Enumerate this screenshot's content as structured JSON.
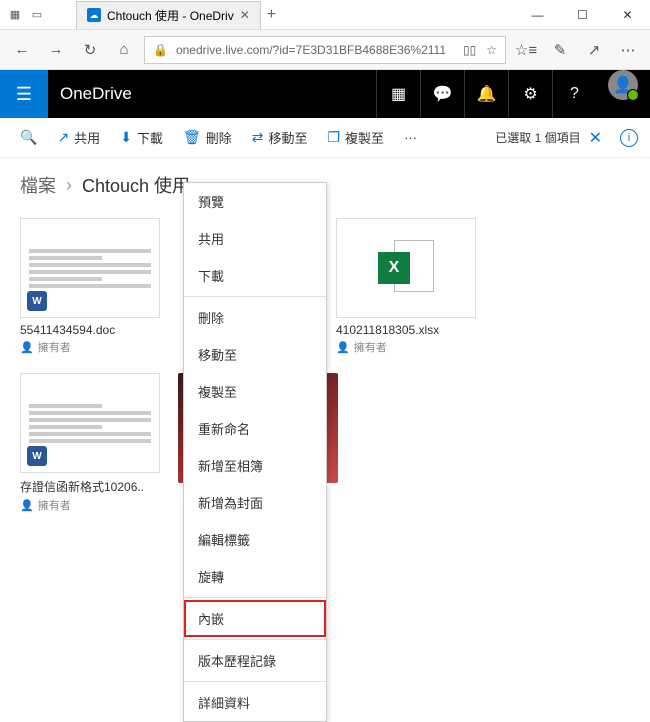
{
  "window": {
    "tab_title": "Chtouch 使用 - OneDriv",
    "min": "—",
    "max": "☐",
    "close": "✕",
    "plus": "+",
    "tabx": "✕"
  },
  "nav": {
    "url": "onedrive.live.com/?id=7E3D31BFB4688E36%2111"
  },
  "header": {
    "brand": "OneDrive"
  },
  "toolbar": {
    "share": "共用",
    "download": "下載",
    "delete": "刪除",
    "move": "移動至",
    "copy": "複製至",
    "more": "···",
    "selection": "已選取 1 個項目",
    "close": "✕"
  },
  "breadcrumb": {
    "root": "檔案",
    "sep": "›",
    "folder": "Chtouch 使用"
  },
  "files": [
    {
      "name": "55411434594.doc",
      "owner": "擁有者"
    },
    {
      "name": "",
      "owner": ""
    },
    {
      "name": "410211818305.xlsx",
      "owner": "擁有者"
    },
    {
      "name": "存證信函新格式10206..",
      "owner": "擁有者"
    }
  ],
  "context_menu": {
    "preview": "預覽",
    "share": "共用",
    "download": "下載",
    "delete": "刪除",
    "move": "移動至",
    "copy": "複製至",
    "rename": "重新命名",
    "addalbum": "新增至相簿",
    "setcover": "新增為封面",
    "edittags": "編輯標籤",
    "rotate": "旋轉",
    "embed": "內嵌",
    "version": "版本歷程記錄",
    "details": "詳細資料"
  }
}
